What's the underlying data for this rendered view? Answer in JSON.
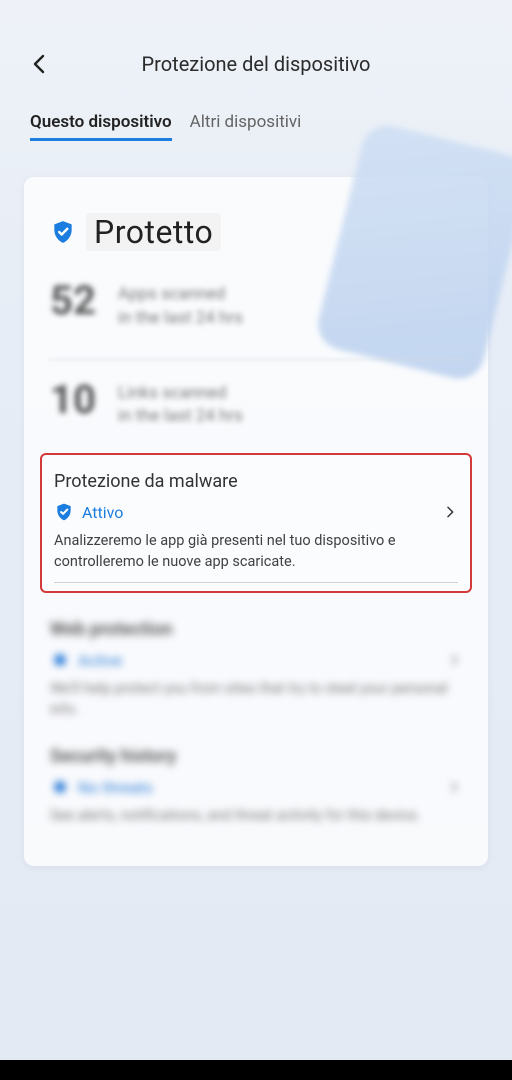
{
  "header": {
    "title": "Protezione del dispositivo"
  },
  "tabs": {
    "this_device": "Questo dispositivo",
    "other_devices": "Altri dispositivi"
  },
  "status": {
    "label": "Protetto"
  },
  "stats": {
    "apps": {
      "count": "52",
      "label_line1": "Apps scanned",
      "label_line2": "in the last 24 hrs"
    },
    "links": {
      "count": "10",
      "label_line1": "Links scanned",
      "label_line2": "in the last 24 hrs"
    }
  },
  "sections": {
    "malware": {
      "title": "Protezione da malware",
      "status": "Attivo",
      "description": "Analizzeremo le app già presenti nel tuo dispositivo e controlleremo le nuove app scaricate."
    },
    "web": {
      "title": "Web protection",
      "status": "Active",
      "description": "We'll help protect you from sites that try to steal your personal info."
    },
    "history": {
      "title": "Security history",
      "status": "No threats",
      "description": "See alerts, notifications, and threat activity for this device."
    }
  },
  "colors": {
    "accent": "#1b7de0",
    "highlight_border": "#d23a3a"
  }
}
